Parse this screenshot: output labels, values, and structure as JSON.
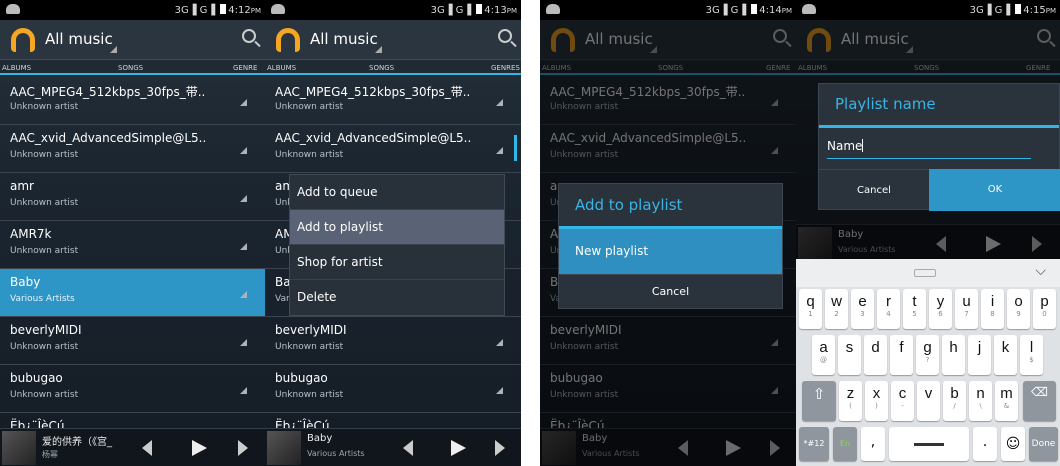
{
  "status": {
    "p1_time": "4:12",
    "p2_time": "4:13",
    "p3_time": "4:14",
    "p4_time": "4:15",
    "ampm": "PM",
    "net": "3G",
    "net2": "G"
  },
  "appbar": {
    "title": "All music"
  },
  "tabs": {
    "left": "ALBUMS",
    "center": "SONGS",
    "right": "GENRES",
    "right_short": "GENRE"
  },
  "songs": [
    {
      "title": "AAC_MPEG4_512kbps_30fps_带..",
      "artist": "Unknown artist"
    },
    {
      "title": "AAC_xvid_AdvancedSimple@L5..",
      "artist": "Unknown artist"
    },
    {
      "title": "amr",
      "artist": "Unknown artist"
    },
    {
      "title": "AMR7k",
      "artist": "Unknown artist"
    },
    {
      "title": "Baby",
      "artist": "Various Artists"
    },
    {
      "title": "beverlyMIDI",
      "artist": "Unknown artist"
    },
    {
      "title": "bubugao",
      "artist": "Unknown artist"
    },
    {
      "title": "Ëb¿¨ÎèCú",
      "artist": ""
    }
  ],
  "nowplaying_1": {
    "title": "爱的供养（《宫_",
    "artist": "杨幂"
  },
  "nowplaying_2": {
    "title": "Baby",
    "artist": "Various Artists"
  },
  "context_menu": [
    "Add to queue",
    "Add to playlist",
    "Shop for artist",
    "Delete"
  ],
  "add_to_playlist": {
    "title": "Add to playlist",
    "item": "New playlist",
    "cancel": "Cancel"
  },
  "playlist_name": {
    "title": "Playlist name",
    "value": "Name",
    "cancel": "Cancel",
    "ok": "OK"
  },
  "keyboard": {
    "row1": [
      [
        "q",
        "1"
      ],
      [
        "w",
        "2"
      ],
      [
        "e",
        "3"
      ],
      [
        "r",
        "4"
      ],
      [
        "t",
        "5"
      ],
      [
        "y",
        "6"
      ],
      [
        "u",
        "7"
      ],
      [
        "i",
        "8"
      ],
      [
        "o",
        "9"
      ],
      [
        "p",
        "0"
      ]
    ],
    "row2": [
      [
        "a",
        "@"
      ],
      [
        "s",
        ""
      ],
      [
        "d",
        ""
      ],
      [
        "f",
        ""
      ],
      [
        "g",
        "?"
      ],
      [
        "h",
        ""
      ],
      [
        "j",
        ""
      ],
      [
        "k",
        ""
      ],
      [
        "l",
        "$"
      ]
    ],
    "row3": [
      [
        "z",
        "("
      ],
      [
        "x",
        ")"
      ],
      [
        "c",
        "-"
      ],
      [
        "v",
        ""
      ],
      [
        "b",
        "/"
      ],
      [
        "n",
        "\\"
      ],
      [
        "m",
        "&"
      ]
    ],
    "sym": "*#12",
    "comma": ",",
    "period": ".",
    "done": "Done"
  },
  "colors": {
    "accent": "#33b5e5",
    "selected_row": "#2e95c7",
    "background": "#1c2630"
  }
}
